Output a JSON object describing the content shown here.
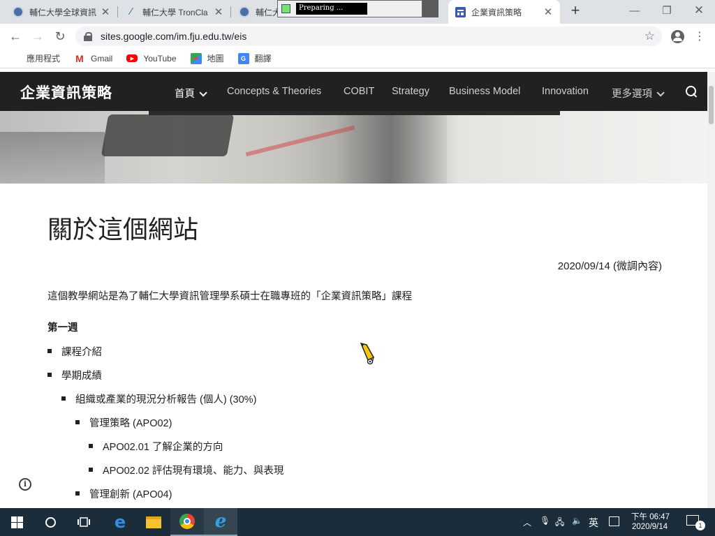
{
  "browser": {
    "tabs": [
      {
        "title": "輔仁大學全球資訊"
      },
      {
        "title": "輔仁大學 TronCla"
      },
      {
        "title": "輔仁大"
      },
      {
        "title": "企業資訊策略"
      }
    ],
    "overlay_text": "Preparing ...",
    "url": "sites.google.com/im.fju.edu.tw/eis",
    "bookmarks": [
      {
        "label": "應用程式"
      },
      {
        "label": "Gmail"
      },
      {
        "label": "YouTube"
      },
      {
        "label": "地圖"
      },
      {
        "label": "翻譯"
      }
    ]
  },
  "site": {
    "title": "企業資訊策略",
    "nav": [
      {
        "label": "首頁"
      },
      {
        "label": "Concepts & Theories"
      },
      {
        "label": "COBIT"
      },
      {
        "label": "Strategy"
      },
      {
        "label": "Business Model"
      },
      {
        "label": "Innovation"
      },
      {
        "label": "更多選項"
      }
    ]
  },
  "content": {
    "title": "關於這個網站",
    "date_note": "2020/09/14 (微調內容)",
    "intro": "這個教學網站是為了輔仁大學資訊管理學系碩士在職專班的「企業資訊策略」課程",
    "week_heading": "第一週",
    "items": [
      {
        "text": "課程介紹"
      },
      {
        "text": "學期成績"
      },
      {
        "text": "組織或產業的現況分析報告 (個人) (30%)"
      },
      {
        "text": "管理策略 (APO02)"
      },
      {
        "text": "APO02.01 了解企業的方向"
      },
      {
        "text": "APO02.02 評估現有環境、能力、與表現"
      },
      {
        "text": "管理創新 (APO04)"
      }
    ]
  },
  "taskbar": {
    "ime": "英",
    "time": "下午 06:47",
    "date": "2020/9/14",
    "notifications": "1"
  },
  "colors": {
    "header_bg": "#212121",
    "taskbar_bg": "#1b2d3a",
    "tabstrip_bg": "#dee1e6"
  }
}
